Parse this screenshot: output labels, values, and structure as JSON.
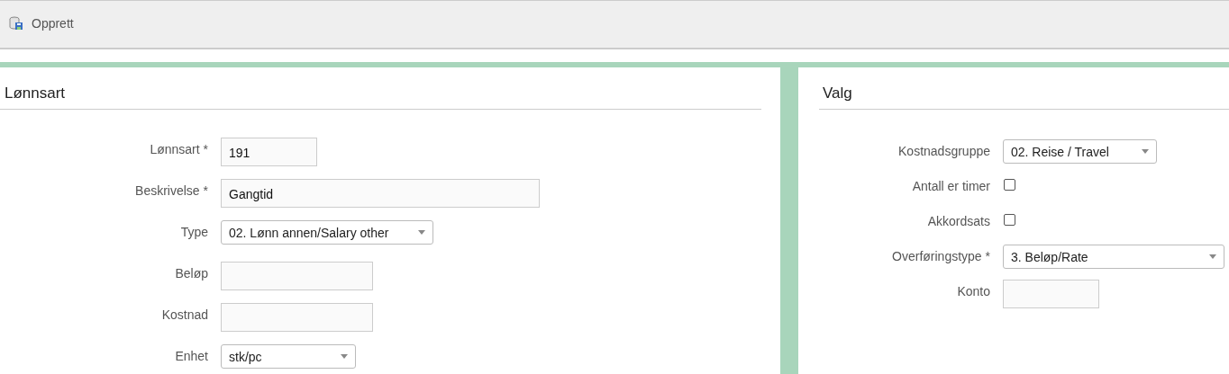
{
  "toolbar": {
    "create_button": "Opprett"
  },
  "panels": [
    {
      "title": "Lønnsart",
      "fields": [
        {
          "kind": "text",
          "label": "Lønnsart *",
          "value": "191"
        },
        {
          "kind": "text",
          "label": "Beskrivelse *",
          "value": "Gangtid"
        },
        {
          "kind": "select",
          "label": "Type",
          "value": "02. Lønn annen/Salary other"
        },
        {
          "kind": "text",
          "label": "Beløp"
        },
        {
          "kind": "text",
          "label": "Kostnad"
        },
        {
          "kind": "select",
          "label": "Enhet",
          "value": "stk/pc"
        }
      ]
    },
    {
      "title": "Valg",
      "fields": [
        {
          "kind": "select",
          "label": "Kostnadsgruppe",
          "value": "02. Reise / Travel"
        },
        {
          "kind": "checkbox",
          "label": "Antall er timer",
          "checked": false
        },
        {
          "kind": "checkbox",
          "label": "Akkordsats",
          "checked": false
        },
        {
          "kind": "select",
          "label": "Overføringstype *",
          "value": "3. Beløp/Rate"
        },
        {
          "kind": "text",
          "label": "Konto"
        }
      ]
    }
  ]
}
